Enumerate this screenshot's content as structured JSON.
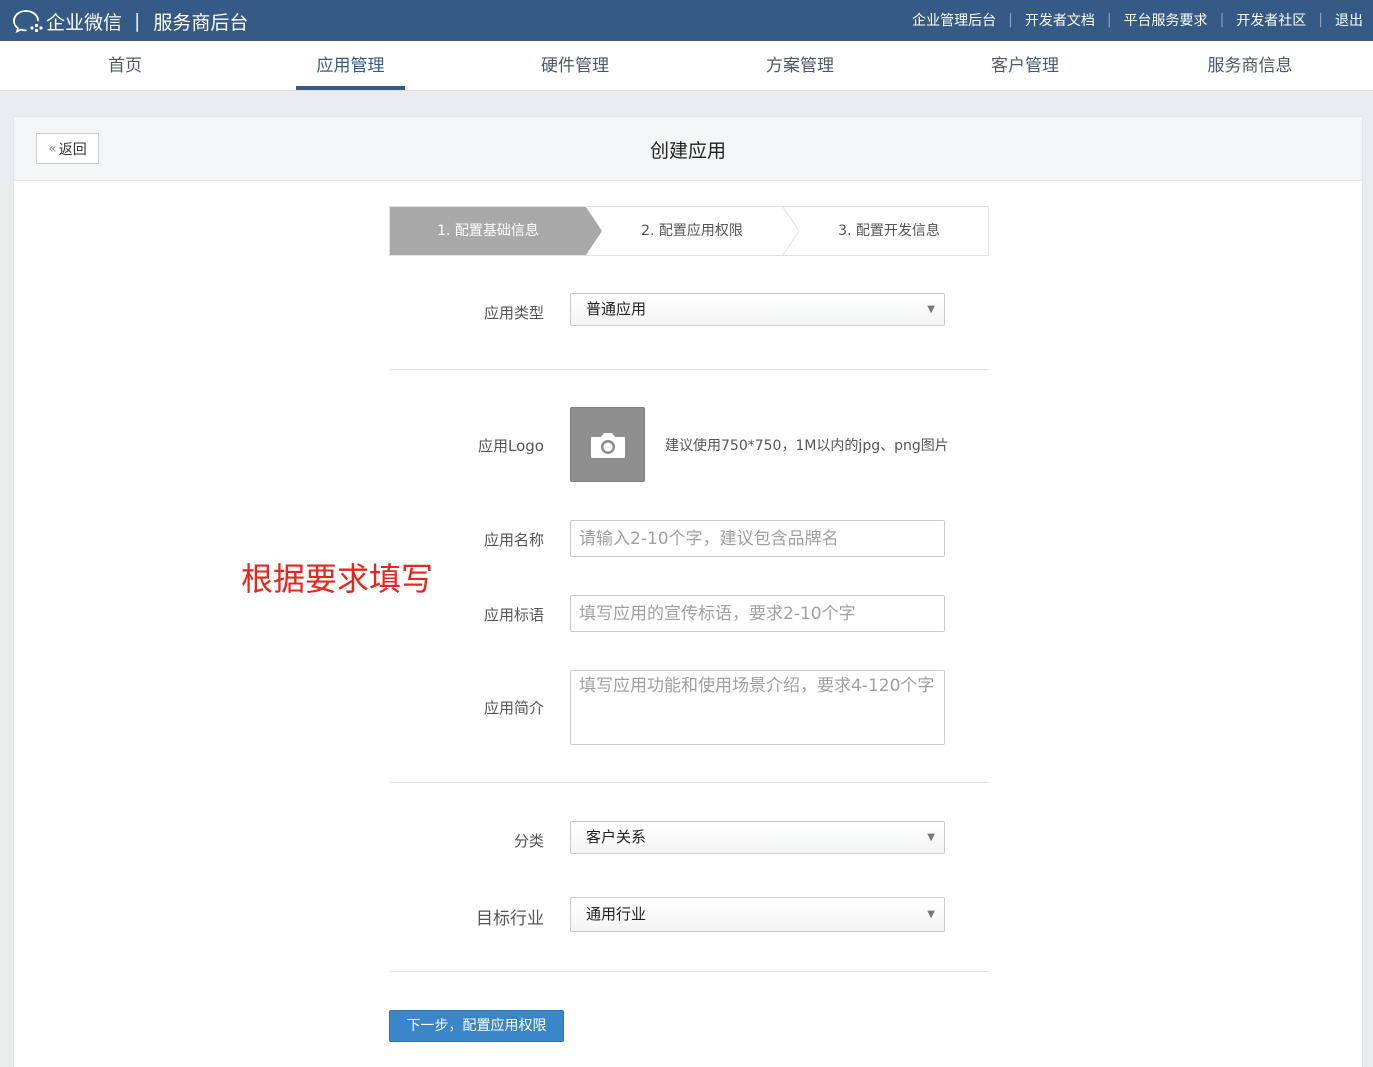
{
  "topbar": {
    "brand_name": "企业微信",
    "brand_sep": "|",
    "brand_sub": "服务商后台",
    "links": [
      "企业管理后台",
      "开发者文档",
      "平台服务要求",
      "开发者社区",
      "退出"
    ]
  },
  "nav": {
    "items": [
      "首页",
      "应用管理",
      "硬件管理",
      "方案管理",
      "客户管理",
      "服务商信息"
    ],
    "active": "应用管理"
  },
  "page": {
    "back_label": "返回",
    "title": "创建应用"
  },
  "steps": {
    "items": [
      "1. 配置基础信息",
      "2. 配置应用权限",
      "3. 配置开发信息"
    ],
    "active_index": 0
  },
  "form": {
    "app_type": {
      "label": "应用类型",
      "value": "普通应用"
    },
    "logo": {
      "label": "应用Logo",
      "hint": "建议使用750*750，1M以内的jpg、png图片"
    },
    "app_name": {
      "label": "应用名称",
      "placeholder": "请输入2-10个字，建议包含品牌名"
    },
    "slogan": {
      "label": "应用标语",
      "placeholder": "填写应用的宣传标语，要求2-10个字"
    },
    "intro": {
      "label": "应用简介",
      "placeholder": "填写应用功能和使用场景介绍，要求4-120个字"
    },
    "category": {
      "label": "分类",
      "value": "客户关系"
    },
    "industry": {
      "label": "目标行业",
      "value": "通用行业"
    },
    "next_label": "下一步，配置应用权限"
  },
  "annotation": "根据要求填写",
  "colors": {
    "topbar": "#355a85",
    "primary_button": "#3a86c8",
    "active_step": "#a9a9a9",
    "annotation": "#e8251b"
  }
}
